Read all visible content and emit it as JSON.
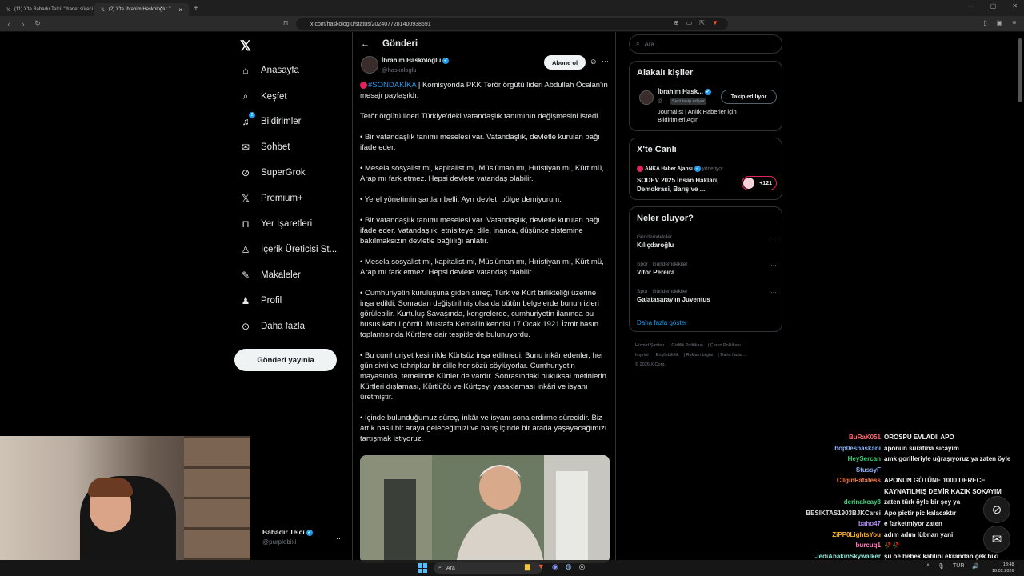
{
  "browser": {
    "tabs": [
      {
        "label": "(11) X'te Bahadır Telci: \"İhanet süreci"
      },
      {
        "label": "(2) X'te İbrahim Haskoloğlu: \""
      }
    ],
    "url": "x.com/haskologlu/status/2024077281400938591"
  },
  "sidebar": {
    "items": [
      {
        "label": "Anasayfa",
        "icon": "home-icon",
        "glyph": "⌂"
      },
      {
        "label": "Keşfet",
        "icon": "search-icon",
        "glyph": "⌕"
      },
      {
        "label": "Bildirimler",
        "icon": "bell-icon",
        "glyph": "🔔",
        "badge": "2"
      },
      {
        "label": "Sohbet",
        "icon": "mail-icon",
        "glyph": "✉"
      },
      {
        "label": "SuperGrok",
        "icon": "grok-icon",
        "glyph": "⊘"
      },
      {
        "label": "Premium+",
        "icon": "x-premium-icon",
        "glyph": "𝕏"
      },
      {
        "label": "Yer İşaretleri",
        "icon": "bookmark-icon",
        "glyph": "🔖"
      },
      {
        "label": "İçerik Üreticisi St...",
        "icon": "creator-icon",
        "glyph": "♙"
      },
      {
        "label": "Makaleler",
        "icon": "article-icon",
        "glyph": "✎"
      },
      {
        "label": "Profil",
        "icon": "person-icon",
        "glyph": "👤"
      },
      {
        "label": "Daha fazla",
        "icon": "more-icon",
        "glyph": "⋯"
      }
    ],
    "post_button": "Gönderi yayınla",
    "account": {
      "name": "Bahadır Telci",
      "handle": "@purplebixi"
    }
  },
  "main": {
    "title": "Gönderi",
    "author": {
      "name": "İbrahim Haskoloğlu",
      "handle": "@haskologlu",
      "subscribe": "Abone ol"
    },
    "hashtag": "#SONDAKİKA",
    "headline_rest": " | Komisyonda PKK Terör örgütü lideri Abdullah Öcalan'ın mesajı paylaşıldı.",
    "paragraphs": [
      "Terör örgütü lideri Türkiye'deki vatandaşlık tanımının değişmesini istedi.",
      "• Bir vatandaşlık tanımı meselesi var. Vatandaşlık, devletle kurulan bağı ifade eder.",
      "• Mesela sosyalist mi, kapitalist mi, Müslüman mı, Hıristiyan mı, Kürt mü, Arap mı fark etmez. Hepsi devlete vatandaş olabilir.",
      "• Yerel yönetimin şartları belli. Ayrı devlet, bölge demiyorum.",
      "• Bir vatandaşlık tanımı meselesi var. Vatandaşlık, devletle kurulan bağı ifade eder. Vatandaşlık; etnisiteye, dile, inanca, düşünce sistemine bakılmaksızın devletle bağlılığı anlatır.",
      "• Mesela sosyalist mi, kapitalist mi, Müslüman mı, Hıristiyan mı, Kürt mü, Arap mı fark etmez. Hepsi devlete vatandaş olabilir.",
      "• Cumhuriyetin kuruluşuna giden süreç, Türk ve Kürt birlikteliği üzerine inşa edildi. Sonradan değiştirilmiş olsa da bütün belgelerde bunun izleri görülebilir. Kurtuluş Savaşında, kongrelerde, cumhuriyetin ilanında bu husus kabul gördü. Mustafa Kemal'in kendisi 17 Ocak 1921 İzmit basın toplantısında Kürtlere dair tespitlerde bulunuyordu.",
      "• Bu cumhuriyet kesinlikle Kürtsüz inşa edilmedi. Bunu inkâr edenler, her gün sivri ve tahripkar bir dille her sözü söylüyorlar. Cumhuriyetin mayasında, temelinde Kürtler de vardır. Sonrasındaki hukuksal metinlerin Kürtleri dışlaması, Kürtlüğü ve Kürtçeyi yasaklaması inkâri ve isyanı üretmiştir.",
      "• İçinde bulunduğumuz süreç, inkâr ve isyanı sona erdirme sürecidir. Biz artık nasıl bir araya geleceğimizi ve barış içinde bir arada yaşayacağımızı tartışmak istiyoruz."
    ]
  },
  "right": {
    "search_placeholder": "Ara",
    "related": {
      "title": "Alakalı kişiler",
      "name": "İbrahim Hask...",
      "handle": "@...",
      "tag": "Seni takip ediyor",
      "button": "Takip ediliyor",
      "bio": "Journalist | Anlık Haberler için Bildirimleri Açın"
    },
    "live": {
      "title": "X'te Canlı",
      "source": "ANKA Haber Ajansı",
      "source_suffix": "yönetiyor",
      "headline": "SODEV 2025 İnsan Hakları, Demokrasi, Barış ve ...",
      "count": "+121"
    },
    "trends": {
      "title": "Neler oluyor?",
      "items": [
        {
          "category": "Gündemdekiler",
          "name": "Kılıçdaroğlu"
        },
        {
          "category": "Spor · Gündemdekiler",
          "name": "Vitor Pereira"
        },
        {
          "category": "Spor · Gündemdekiler",
          "name": "Galatasaray'ın Juventus"
        }
      ],
      "show_more": "Daha fazla göster"
    },
    "footer": [
      "Hizmet Şartları",
      "Gizlilik Politikası",
      "Çerez Politikası",
      "Imprint",
      "Erişilebilirlik",
      "Reklam bilgisi",
      "Daha fazla ...",
      "© 2026 X Corp."
    ]
  },
  "chat": [
    {
      "user": "BuRaK051",
      "color": "#ff6b6b",
      "msg": "OROSPU EVLADII APO"
    },
    {
      "user": "bop0esbaskani",
      "color": "#8fb6ff",
      "msg": "aponun suratına sıcayım"
    },
    {
      "user": "HeySercan",
      "color": "#3bd17b",
      "msg": "amk gorilleriyle uğraşıyoruz ya zaten öyle"
    },
    {
      "user": "StussyF",
      "color": "#8fb6ff",
      "msg": ""
    },
    {
      "user": "CllginPatatess",
      "color": "#ff7b4a",
      "msg": "APONUN GÖTÜNE 1000 DERECE KAYNATILMIŞ DEMİR KAZIK SOKAYIM"
    },
    {
      "user": "derinakcay8",
      "color": "#49d17d",
      "msg": "zaten türk öyle bir şey ya"
    },
    {
      "user": "BESIKTAS1903BJKCarsi",
      "color": "#d9d9d9",
      "msg": "Apo pictir pic kalacaktır"
    },
    {
      "user": "baho47",
      "color": "#b18cff",
      "msg": "e farketmiyor zaten"
    },
    {
      "user": "ZiPP0LightsYou",
      "color": "#ffb020",
      "msg": "adım adım lübnan yani"
    },
    {
      "user": "burcuq1",
      "color": "#ff7ab8",
      "msg": "🥀🥀"
    },
    {
      "user": "JediAnakinSkywalker",
      "color": "#8fe6d9",
      "msg": "şu oe bebek katilini ekrandan çek bixi"
    }
  ],
  "taskbar": {
    "search": "Ara",
    "lang": "TUR",
    "time": "18:48",
    "date": "18.02.2026"
  }
}
